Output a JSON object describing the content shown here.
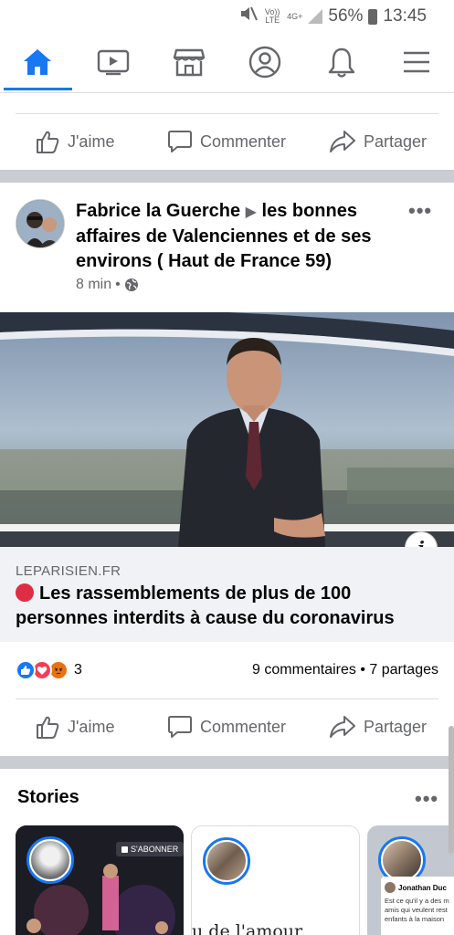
{
  "status_bar": {
    "volte": "Vo)) LTE",
    "network": "4G+",
    "battery": "56%",
    "time": "13:45"
  },
  "nav": {
    "items": [
      {
        "name": "home",
        "icon": "home-icon",
        "active": true
      },
      {
        "name": "watch",
        "icon": "video-icon"
      },
      {
        "name": "marketplace",
        "icon": "shop-icon"
      },
      {
        "name": "profile",
        "icon": "user-icon"
      },
      {
        "name": "notifications",
        "icon": "bell-icon"
      },
      {
        "name": "menu",
        "icon": "hamburger-icon"
      }
    ],
    "accent": "#1877f2"
  },
  "prev_post_actions": {
    "like": "J'aime",
    "comment": "Commenter",
    "share": "Partager"
  },
  "post": {
    "author": "Fabrice la Guerche",
    "group": "les bonnes affaires de Valenciennes et de ses environs ( Haut de France 59)",
    "time": "8 min",
    "privacy_icon": "globe-icon",
    "link": {
      "domain": "LEPARISIEN.FR",
      "headline": "Les rassemblements de plus de 100 personnes interdits à cause du coronavirus"
    },
    "reactions": {
      "types": [
        "like",
        "love",
        "angry"
      ],
      "count": "3"
    },
    "comments": "9 commentaires",
    "separator": "•",
    "shares": "7 partages",
    "actions": {
      "like": "J'aime",
      "comment": "Commenter",
      "share": "Partager"
    }
  },
  "stories": {
    "title": "Stories",
    "cards": [
      {
        "subscribe_label": "S'ABONNER"
      },
      {
        "caption": "u de l'amour"
      },
      {
        "author": "Jonathan Duc",
        "text": "Est ce qu'il y a des m amis qui veulent rest enfants à la maison"
      }
    ]
  }
}
